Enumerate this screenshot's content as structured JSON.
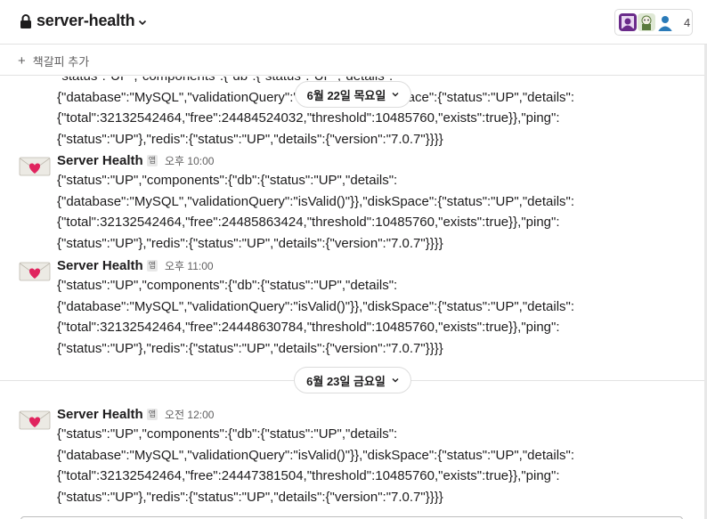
{
  "header": {
    "channel_name": "server-health",
    "member_count": "4"
  },
  "bookmarks": {
    "add_label": "책갈피 추가"
  },
  "messages_top_partial": [
    "\"status\":\"UP\",\"components\":{\"db\":{\"status\":\"UP\",\"details\":",
    "{\"database\":\"MySQL\",\"validationQuery\":\"isValid()\"}},\"diskSpace\":{\"status\":\"UP\",\"details\":",
    "{\"total\":32132542464,\"free\":24484524032,\"threshold\":10485760,\"exists\":true}},\"ping\":",
    "{\"status\":\"UP\"},\"redis\":{\"status\":\"UP\",\"details\":{\"version\":\"7.0.7\"}}}}"
  ],
  "date_dividers": [
    {
      "label": "6월 22일 목요일"
    },
    {
      "label": "6월 23일 금요일"
    }
  ],
  "messages": [
    {
      "sender": "Server Health",
      "badge": "앱",
      "time": "오후 10:00",
      "lines": [
        "{\"status\":\"UP\",\"components\":{\"db\":{\"status\":\"UP\",\"details\":",
        "{\"database\":\"MySQL\",\"validationQuery\":\"isValid()\"}},\"diskSpace\":{\"status\":\"UP\",\"details\":",
        "{\"total\":32132542464,\"free\":24485863424,\"threshold\":10485760,\"exists\":true}},\"ping\":",
        "{\"status\":\"UP\"},\"redis\":{\"status\":\"UP\",\"details\":{\"version\":\"7.0.7\"}}}}"
      ]
    },
    {
      "sender": "Server Health",
      "badge": "앱",
      "time": "오후 11:00",
      "lines": [
        "{\"status\":\"UP\",\"components\":{\"db\":{\"status\":\"UP\",\"details\":",
        "{\"database\":\"MySQL\",\"validationQuery\":\"isValid()\"}},\"diskSpace\":{\"status\":\"UP\",\"details\":",
        "{\"total\":32132542464,\"free\":24448630784,\"threshold\":10485760,\"exists\":true}},\"ping\":",
        "{\"status\":\"UP\"},\"redis\":{\"status\":\"UP\",\"details\":{\"version\":\"7.0.7\"}}}}"
      ]
    },
    {
      "sender": "Server Health",
      "badge": "앱",
      "time": "오전 12:00",
      "lines": [
        "{\"status\":\"UP\",\"components\":{\"db\":{\"status\":\"UP\",\"details\":",
        "{\"database\":\"MySQL\",\"validationQuery\":\"isValid()\"}},\"diskSpace\":{\"status\":\"UP\",\"details\":",
        "{\"total\":32132542464,\"free\":24447381504,\"threshold\":10485760,\"exists\":true}},\"ping\":",
        "{\"status\":\"UP\"},\"redis\":{\"status\":\"UP\",\"details\":{\"version\":\"7.0.7\"}}}}"
      ]
    }
  ],
  "icons": {
    "channel": "lock-icon",
    "dropdown": "chevron-down-icon",
    "bookmark": "plus-icon",
    "app_avatar": "love-letter-icon"
  },
  "colors": {
    "heart": "#e0245e",
    "envelope": "#e9e6e0",
    "border": "#e2e2e2"
  }
}
